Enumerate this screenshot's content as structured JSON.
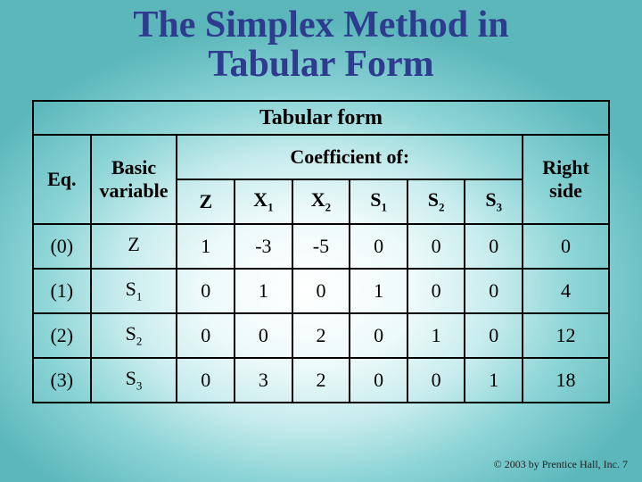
{
  "title_line1": "The Simplex Method in",
  "title_line2": "Tabular Form",
  "table_caption": "Tabular form",
  "headers": {
    "eq": "Eq.",
    "basic_variable": "Basic variable",
    "coefficient_of": "Coefficient of:",
    "right_side": "Right side",
    "cols": {
      "z": "Z",
      "x1": "X",
      "x1_sub": "1",
      "x2": "X",
      "x2_sub": "2",
      "s1": "S",
      "s1_sub": "1",
      "s2": "S",
      "s2_sub": "2",
      "s3": "S",
      "s3_sub": "3"
    }
  },
  "rows": [
    {
      "eq": "(0)",
      "bv": "Z",
      "bv_sub": "",
      "z": "1",
      "x1": "-3",
      "x2": "-5",
      "s1": "0",
      "s2": "0",
      "s3": "0",
      "rhs": "0"
    },
    {
      "eq": "(1)",
      "bv": "S",
      "bv_sub": "1",
      "z": "0",
      "x1": "1",
      "x2": "0",
      "s1": "1",
      "s2": "0",
      "s3": "0",
      "rhs": "4"
    },
    {
      "eq": "(2)",
      "bv": "S",
      "bv_sub": "2",
      "z": "0",
      "x1": "0",
      "x2": "2",
      "s1": "0",
      "s2": "1",
      "s3": "0",
      "rhs": "12"
    },
    {
      "eq": "(3)",
      "bv": "S",
      "bv_sub": "3",
      "z": "0",
      "x1": "3",
      "x2": "2",
      "s1": "0",
      "s2": "0",
      "s3": "1",
      "rhs": "18"
    }
  ],
  "footer": "© 2003 by Prentice Hall, Inc.  7",
  "chart_data": {
    "type": "table",
    "title": "Tabular form",
    "columns": [
      "Eq.",
      "Basic variable",
      "Z",
      "X1",
      "X2",
      "S1",
      "S2",
      "S3",
      "Right side"
    ],
    "rows": [
      [
        "(0)",
        "Z",
        1,
        -3,
        -5,
        0,
        0,
        0,
        0
      ],
      [
        "(1)",
        "S1",
        0,
        1,
        0,
        1,
        0,
        0,
        4
      ],
      [
        "(2)",
        "S2",
        0,
        0,
        2,
        0,
        1,
        0,
        12
      ],
      [
        "(3)",
        "S3",
        0,
        3,
        2,
        0,
        0,
        1,
        18
      ]
    ]
  }
}
